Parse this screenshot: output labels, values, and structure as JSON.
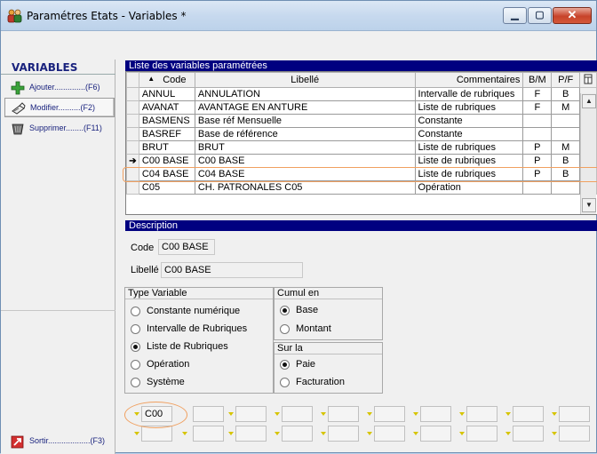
{
  "window": {
    "title": "Paramétres Etats - Variables *"
  },
  "left_panel": {
    "title": "VARIABLES",
    "actions": [
      {
        "label": "Ajouter..............(F6)",
        "icon": "plus-icon"
      },
      {
        "label": "Modifier..........(F2)",
        "icon": "edit-icon"
      },
      {
        "label": "Supprimer........(F11)",
        "icon": "trash-icon"
      }
    ],
    "exit_label": "Sortir...................(F3)"
  },
  "list": {
    "header": "Liste des variables paramétrées",
    "columns": {
      "code": "Code",
      "libelle": "Libellé",
      "commentaires": "Commentaires",
      "bm": "B/M",
      "pf": "P/F"
    },
    "rows": [
      {
        "code": "ANNUL",
        "libelle": "ANNULATION",
        "commentaire": "Intervalle de rubriques",
        "bm": "F",
        "pf": "B"
      },
      {
        "code": "AVANAT",
        "libelle": "AVANTAGE EN ANTURE",
        "commentaire": "Liste de rubriques",
        "bm": "F",
        "pf": "M"
      },
      {
        "code": "BASMENS",
        "libelle": "Base réf Mensuelle",
        "commentaire": "Constante",
        "bm": "",
        "pf": ""
      },
      {
        "code": "BASREF",
        "libelle": "Base de référence",
        "commentaire": "Constante",
        "bm": "",
        "pf": ""
      },
      {
        "code": "BRUT",
        "libelle": "BRUT",
        "commentaire": "Liste de rubriques",
        "bm": "P",
        "pf": "M"
      },
      {
        "code": "C00 BASE",
        "libelle": "C00 BASE",
        "commentaire": "Liste de rubriques",
        "bm": "P",
        "pf": "B"
      },
      {
        "code": "C04 BASE",
        "libelle": "C04 BASE",
        "commentaire": "Liste de rubriques",
        "bm": "P",
        "pf": "B"
      },
      {
        "code": "C05",
        "libelle": "CH. PATRONALES C05",
        "commentaire": "Opération",
        "bm": "",
        "pf": ""
      }
    ],
    "selected_index": 5
  },
  "description": {
    "header": "Description",
    "code_label": "Code",
    "code_value": "C00 BASE",
    "libelle_label": "Libellé",
    "libelle_value": "C00 BASE",
    "type_variable": {
      "title": "Type Variable",
      "options": [
        "Constante numérique",
        "Intervalle de Rubriques",
        "Liste de Rubriques",
        "Opération",
        "Système"
      ],
      "selected": 2
    },
    "cumul_en": {
      "title": "Cumul en",
      "options": [
        "Base",
        "Montant"
      ],
      "selected": 0
    },
    "sur_la": {
      "title": "Sur la",
      "options": [
        "Paie",
        "Facturation"
      ],
      "selected": 0
    },
    "rubrique_fields": {
      "first_value": "C00"
    }
  }
}
